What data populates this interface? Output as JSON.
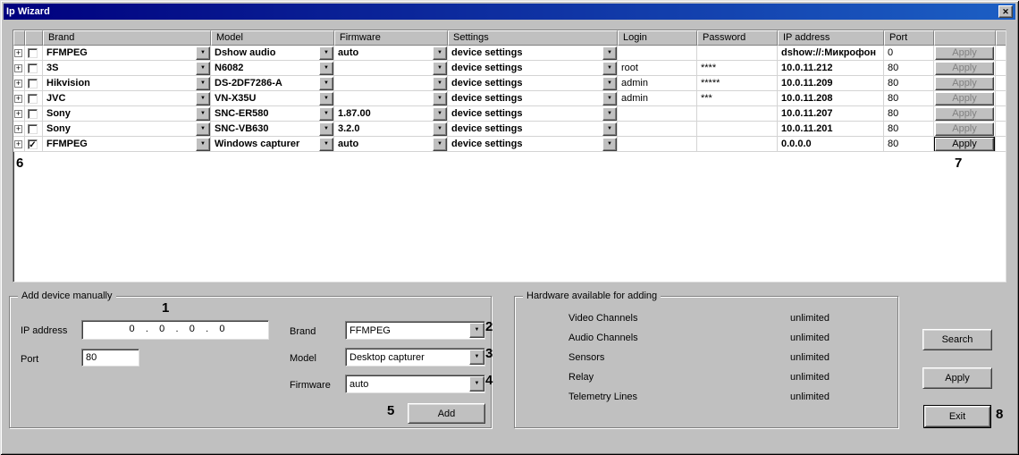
{
  "window": {
    "title": "Ip Wizard"
  },
  "icons": {
    "close": "✕",
    "dropdown": "▼",
    "expand": "+",
    "check": "✓"
  },
  "grid": {
    "headers": {
      "brand": "Brand",
      "model": "Model",
      "firmware": "Firmware",
      "settings": "Settings",
      "login": "Login",
      "password": "Password",
      "ip": "IP address",
      "port": "Port"
    },
    "rows": [
      {
        "check": "",
        "brand": "FFMPEG",
        "model": "Dshow audio",
        "firmware": "auto",
        "settings": "device settings",
        "login": "",
        "password": "",
        "ip": "dshow://:Микрофон",
        "port": "0",
        "apply": "Apply"
      },
      {
        "check": "",
        "brand": "3S",
        "model": "N6082",
        "firmware": "",
        "settings": "device settings",
        "login": "root",
        "password": "****",
        "ip": "10.0.11.212",
        "port": "80",
        "apply": "Apply"
      },
      {
        "check": "",
        "brand": "Hikvision",
        "model": "DS-2DF7286-A",
        "firmware": "",
        "settings": "device settings",
        "login": "admin",
        "password": "*****",
        "ip": "10.0.11.209",
        "port": "80",
        "apply": "Apply"
      },
      {
        "check": "",
        "brand": "JVC",
        "model": "VN-X35U",
        "firmware": "",
        "settings": "device settings",
        "login": "admin",
        "password": "***",
        "ip": "10.0.11.208",
        "port": "80",
        "apply": "Apply"
      },
      {
        "check": "",
        "brand": "Sony",
        "model": "SNC-ER580",
        "firmware": "1.87.00",
        "settings": "device settings",
        "login": "",
        "password": "",
        "ip": "10.0.11.207",
        "port": "80",
        "apply": "Apply"
      },
      {
        "check": "",
        "brand": "Sony",
        "model": "SNC-VB630",
        "firmware": "3.2.0",
        "settings": "device settings",
        "login": "",
        "password": "",
        "ip": "10.0.11.201",
        "port": "80",
        "apply": "Apply"
      },
      {
        "check": "✓",
        "brand": "FFMPEG",
        "model": "Windows capturer",
        "firmware": "auto",
        "settings": "device settings",
        "login": "",
        "password": "",
        "ip": "0.0.0.0",
        "port": "80",
        "apply": "Apply"
      }
    ]
  },
  "add_device": {
    "group_label": "Add device manually",
    "ip_label": "IP address",
    "ip_value": "0    .    0    .    0    .    0",
    "port_label": "Port",
    "port_value": "80",
    "brand_label": "Brand",
    "brand_value": "FFMPEG",
    "model_label": "Model",
    "model_value": "Desktop capturer",
    "firmware_label": "Firmware",
    "firmware_value": "auto",
    "add_button": "Add"
  },
  "hardware": {
    "group_label": "Hardware available for adding",
    "items": [
      {
        "label": "Video Channels",
        "value": "unlimited"
      },
      {
        "label": "Audio Channels",
        "value": "unlimited"
      },
      {
        "label": "Sensors",
        "value": "unlimited"
      },
      {
        "label": "Relay",
        "value": "unlimited"
      },
      {
        "label": "Telemetry Lines",
        "value": "unlimited"
      }
    ]
  },
  "buttons": {
    "search": "Search",
    "apply": "Apply",
    "exit": "Exit"
  },
  "annotations": {
    "a1": "1",
    "a2": "2",
    "a3": "3",
    "a4": "4",
    "a5": "5",
    "a6": "6",
    "a7": "7",
    "a8": "8"
  }
}
